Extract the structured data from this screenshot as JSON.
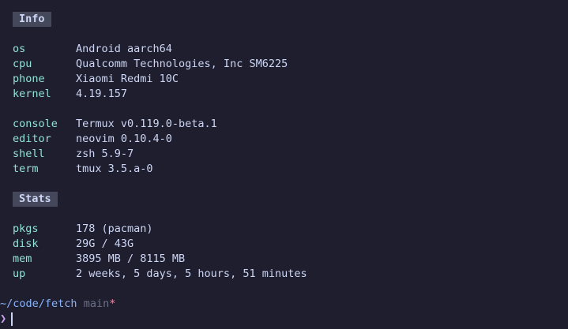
{
  "info": {
    "header": "Info",
    "rows": [
      {
        "key": "os",
        "value": "Android aarch64"
      },
      {
        "key": "cpu",
        "value": "Qualcomm Technologies, Inc SM6225"
      },
      {
        "key": "phone",
        "value": "Xiaomi Redmi 10C"
      },
      {
        "key": "kernel",
        "value": "4.19.157"
      },
      {
        "key": "console",
        "value": "Termux v0.119.0-beta.1"
      },
      {
        "key": "editor",
        "value": "neovim 0.10.4-0"
      },
      {
        "key": "shell",
        "value": "zsh 5.9-7"
      },
      {
        "key": "term",
        "value": "tmux 3.5.a-0"
      }
    ]
  },
  "stats": {
    "header": "Stats",
    "rows": [
      {
        "key": "pkgs",
        "value": "178 (pacman)"
      },
      {
        "key": "disk",
        "value": "29G / 43G"
      },
      {
        "key": "mem",
        "value": "3895 MB / 8115 MB"
      },
      {
        "key": "up",
        "value": "2 weeks, 5 days, 5 hours, 51 minutes"
      }
    ]
  },
  "prompt": {
    "path": "~/code/fetch",
    "branch": "main",
    "dirty_marker": "*",
    "symbol": "❯"
  },
  "colors": {
    "background": "#1e1e2e",
    "key": "#94e2d5",
    "value": "#cdd6f4",
    "header_bg": "#45475a",
    "path": "#89b4fa",
    "branch": "#6c7086",
    "dirty": "#f38ba8",
    "prompt_symbol": "#cba6f7"
  }
}
